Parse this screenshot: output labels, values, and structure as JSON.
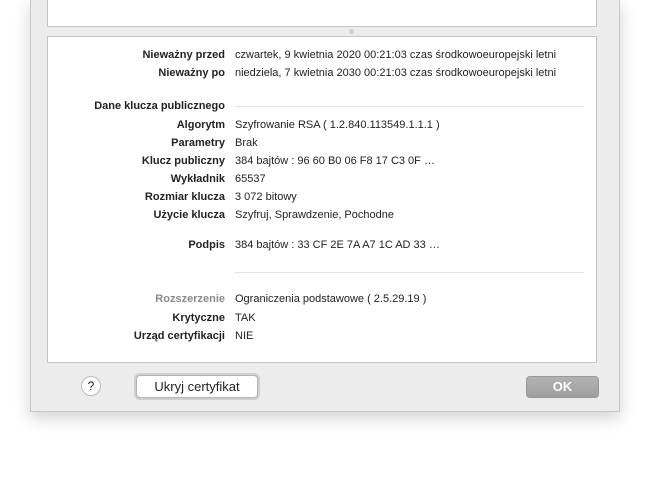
{
  "fields": [
    {
      "label": "Nieważny przed",
      "value": "czwartek, 9 kwietnia 2020 00:21:03 czas środkowoeuropejski letni"
    },
    {
      "label": "Nieważny po",
      "value": "niedziela, 7 kwietnia 2030 00:21:03 czas środkowoeuropejski letni"
    },
    {
      "label": "Dane klucza publicznego",
      "value": ""
    },
    {
      "label": "Algorytm",
      "value": "Szyfrowanie RSA ( 1.2.840.113549.1.1.1 )"
    },
    {
      "label": "Parametry",
      "value": "Brak"
    },
    {
      "label": "Klucz publiczny",
      "value": "384 bajtów : 96 60 B0 06 F8 17 C3 0F …"
    },
    {
      "label": "Wykładnik",
      "value": "65537"
    },
    {
      "label": "Rozmiar klucza",
      "value": "3 072 bitowy"
    },
    {
      "label": "Użycie klucza",
      "value": "Szyfruj, Sprawdzenie, Pochodne"
    },
    {
      "label": "Podpis",
      "value": "384 bajtów : 33 CF 2E 7A A7 1C AD 33 …"
    },
    {
      "label": "Rozszerzenie",
      "value": "Ograniczenia podstawowe ( 2.5.29.19 )"
    },
    {
      "label": "Krytyczne",
      "value": "TAK"
    },
    {
      "label": "Urząd certyfikacji",
      "value": "NIE"
    }
  ],
  "buttons": {
    "help": "?",
    "hide": "Ukryj certyfikat",
    "ok": "OK"
  }
}
